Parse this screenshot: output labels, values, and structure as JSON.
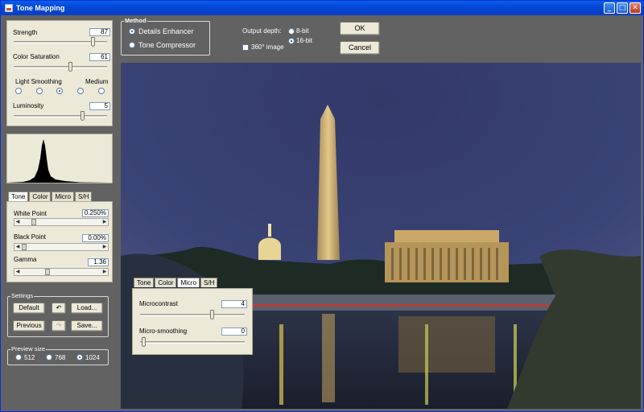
{
  "window": {
    "title": "Tone Mapping"
  },
  "sliders": {
    "strength": {
      "label": "Strength",
      "value": "87"
    },
    "color_saturation": {
      "label": "Color Saturation",
      "value": "61"
    },
    "light_smoothing": {
      "label": "Light Smoothing",
      "right_label": "Medium",
      "selected_index": 2,
      "count": 5
    },
    "luminosity": {
      "label": "Luminosity",
      "value": "5"
    }
  },
  "tabs_left": [
    "Tone",
    "Color",
    "Micro",
    "S/H"
  ],
  "tone": {
    "white_point": {
      "label": "White Point",
      "value": "0.250%"
    },
    "black_point": {
      "label": "Black Point",
      "value": "0.00%"
    },
    "gamma": {
      "label": "Gamma",
      "value": "1.36"
    }
  },
  "settings": {
    "group_label": "Settings",
    "default": "Default",
    "load": "Load...",
    "previous": "Previous",
    "save": "Save..."
  },
  "preview": {
    "group_label": "Preview size",
    "options": [
      "512",
      "768",
      "1024"
    ],
    "selected": "1024"
  },
  "method": {
    "group_label": "Method",
    "options": [
      "Details Enhancer",
      "Tone Compressor"
    ],
    "selected": "Details Enhancer"
  },
  "output": {
    "label": "Output depth:",
    "options": [
      "8-bit",
      "16-bit"
    ],
    "selected": "16-bit",
    "checkbox_360": "360° image"
  },
  "buttons": {
    "ok": "OK",
    "cancel": "Cancel"
  },
  "float_panel": {
    "tabs": [
      "Tone",
      "Color",
      "Micro",
      "S/H"
    ],
    "active_tab": "Micro",
    "microcontrast": {
      "label": "Microcontrast",
      "value": "4"
    },
    "micro_smoothing": {
      "label": "Micro-smoothing",
      "value": "0"
    }
  },
  "colors": {
    "titlebar": "#0a5ee8",
    "panel": "#ece9d8",
    "background": "#626262"
  }
}
